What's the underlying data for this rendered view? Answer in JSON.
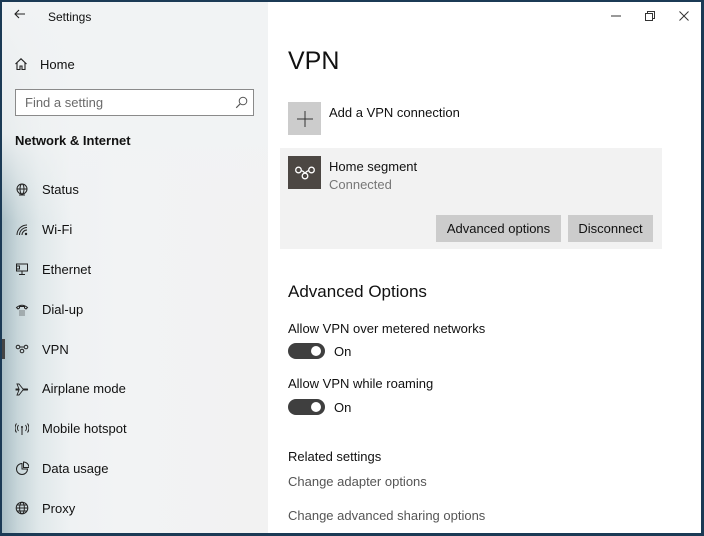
{
  "window": {
    "title": "Settings",
    "controls": {
      "minimize": "minimize",
      "restore": "restore",
      "close": "close"
    }
  },
  "sidebar": {
    "home_label": "Home",
    "search": {
      "placeholder": "Find a setting",
      "value": ""
    },
    "section_title": "Network & Internet",
    "items": [
      {
        "label": "Status",
        "icon": "globe-status-icon",
        "active": false
      },
      {
        "label": "Wi-Fi",
        "icon": "wifi-icon",
        "active": false
      },
      {
        "label": "Ethernet",
        "icon": "ethernet-icon",
        "active": false
      },
      {
        "label": "Dial-up",
        "icon": "dialup-icon",
        "active": false
      },
      {
        "label": "VPN",
        "icon": "vpn-icon",
        "active": true
      },
      {
        "label": "Airplane mode",
        "icon": "airplane-icon",
        "active": false
      },
      {
        "label": "Mobile hotspot",
        "icon": "hotspot-icon",
        "active": false
      },
      {
        "label": "Data usage",
        "icon": "data-usage-icon",
        "active": false
      },
      {
        "label": "Proxy",
        "icon": "globe-proxy-icon",
        "active": false
      }
    ]
  },
  "main": {
    "page_title": "VPN",
    "add_vpn_label": "Add a VPN connection",
    "connection": {
      "name": "Home segment",
      "status": "Connected",
      "advanced_button": "Advanced options",
      "disconnect_button": "Disconnect"
    },
    "advanced_title": "Advanced Options",
    "options": [
      {
        "label": "Allow VPN over metered networks",
        "state": "On",
        "enabled": true
      },
      {
        "label": "Allow VPN while roaming",
        "state": "On",
        "enabled": true
      }
    ],
    "related": {
      "title": "Related settings",
      "links": [
        "Change adapter options",
        "Change advanced sharing options"
      ]
    }
  }
}
